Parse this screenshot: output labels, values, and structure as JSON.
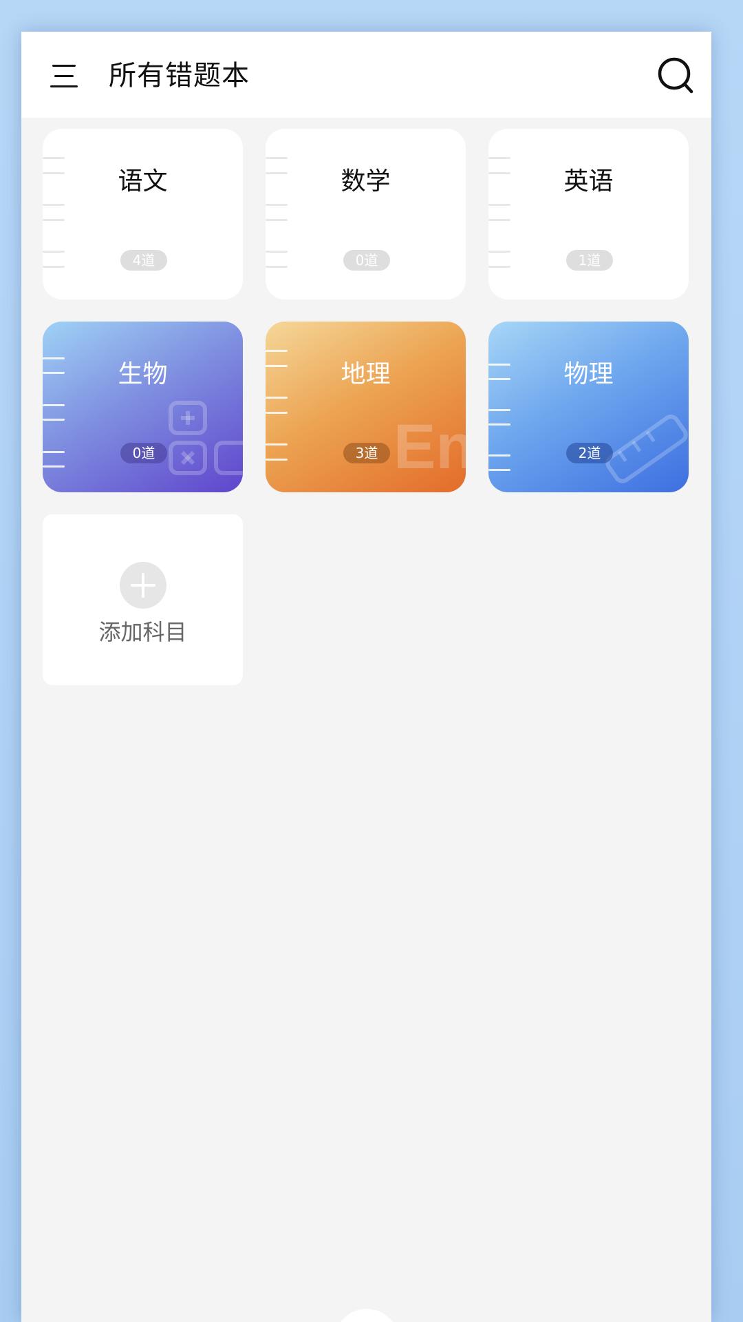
{
  "header": {
    "title": "所有错题本"
  },
  "subjects": [
    {
      "name": "语文",
      "count": "4道"
    },
    {
      "name": "数学",
      "count": "0道"
    },
    {
      "name": "英语",
      "count": "1道"
    },
    {
      "name": "生物",
      "count": "0道"
    },
    {
      "name": "地理",
      "count": "3道"
    },
    {
      "name": "物理",
      "count": "2道"
    }
  ],
  "add_card": {
    "label": "添加科目"
  },
  "icons": {
    "menu": "menu-icon",
    "search": "search-icon",
    "add": "plus-icon"
  },
  "colors": {
    "page_background": "#b6d6f6",
    "content_background": "#f4f4f5",
    "biology_gradient": [
      "#9fd2f5",
      "#5f45cc"
    ],
    "geography_gradient": [
      "#f5d79a",
      "#e36c2a"
    ],
    "physics_gradient": [
      "#a7d6f6",
      "#3d6fe0"
    ]
  }
}
